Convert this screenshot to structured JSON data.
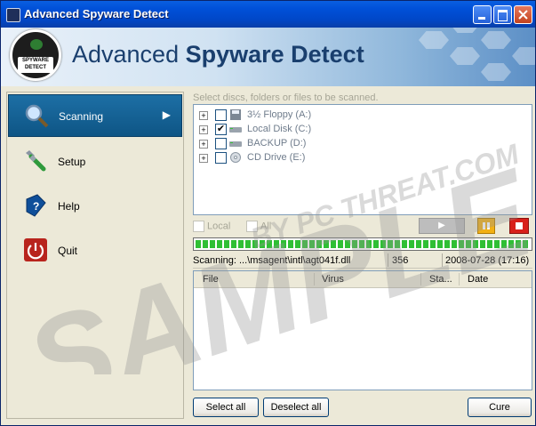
{
  "window": {
    "title": "Advanced Spyware Detect",
    "brand_light": "Advanced ",
    "brand_bold": "Spyware Detect",
    "logo_line1": "SPYWARE",
    "logo_line2": "DETECT"
  },
  "nav": {
    "items": [
      {
        "label": "Scanning",
        "icon": "magnifier-icon",
        "active": true
      },
      {
        "label": "Setup",
        "icon": "wrench-icon"
      },
      {
        "label": "Help",
        "icon": "help-book-icon"
      },
      {
        "label": "Quit",
        "icon": "power-icon"
      }
    ]
  },
  "scan": {
    "hint": "Select discs, folders or files to be scanned.",
    "tree": [
      {
        "label": "3½ Floppy (A:)",
        "checked": false,
        "icon": "floppy-icon"
      },
      {
        "label": "Local Disk (C:)",
        "checked": true,
        "icon": "hard-disk-icon"
      },
      {
        "label": "BACKUP (D:)",
        "checked": false,
        "icon": "hard-disk-icon"
      },
      {
        "label": "CD Drive (E:)",
        "checked": false,
        "icon": "cd-drive-icon"
      }
    ],
    "opt_local": "Local",
    "opt_all": "All",
    "progress": 1.0,
    "status_path": "Scanning: ...\\msagent\\intl\\agt041f.dll",
    "status_count": "356",
    "status_date": "2008-07-28 (17:16)"
  },
  "results": {
    "columns": [
      "File",
      "Virus",
      "Sta...",
      "Date"
    ],
    "rows": []
  },
  "buttons": {
    "select_all": "Select all",
    "deselect_all": "Deselect all",
    "cure": "Cure"
  },
  "watermark": {
    "main": "SAMPLE",
    "sub": "BY PC THREAT.COM"
  },
  "colors": {
    "titlebar": "#0050D8",
    "nav_active": "#1d6fa5",
    "progress": "#2fbf34",
    "pause": "#f2b014",
    "stop": "#d8201a"
  }
}
